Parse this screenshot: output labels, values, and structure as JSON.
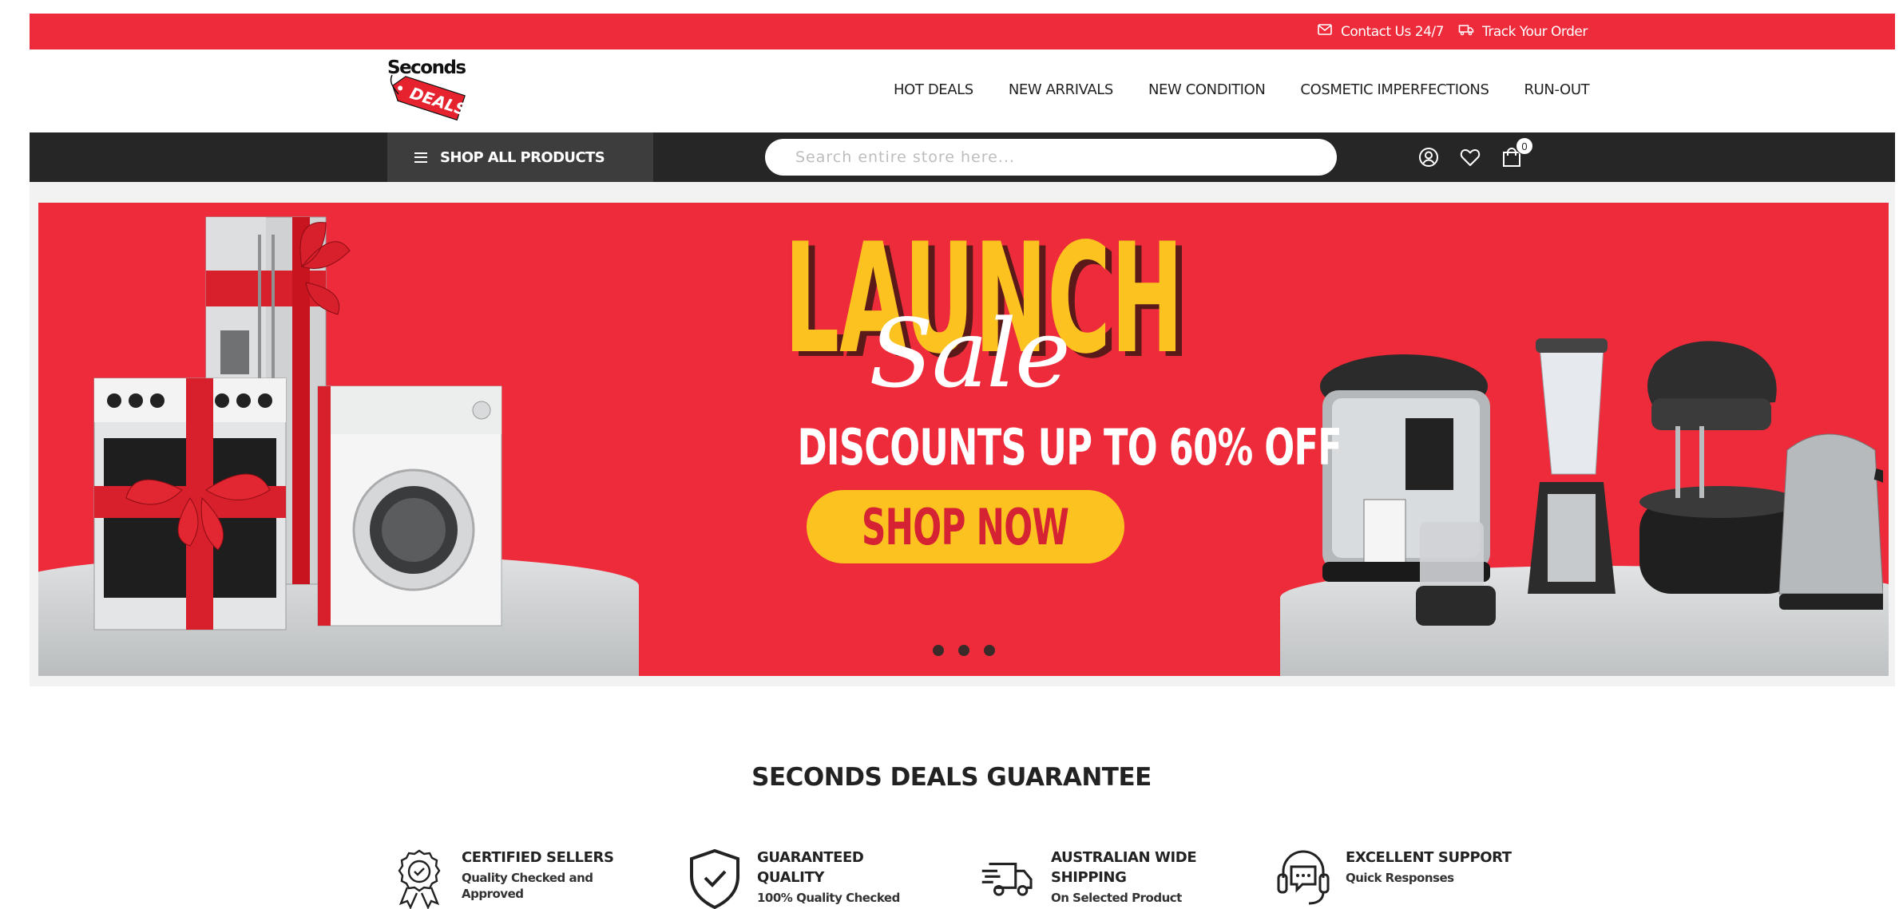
{
  "topbar": {
    "contact_label": "Contact Us 24/7",
    "track_label": "Track Your Order"
  },
  "header": {
    "logo_text_top": "Seconds",
    "logo_text_tag": "DEALS",
    "nav": [
      "HOT DEALS",
      "NEW ARRIVALS",
      "NEW CONDITION",
      "COSMETIC IMPERFECTIONS",
      "RUN-OUT"
    ]
  },
  "toolbar": {
    "shop_all_label": "SHOP ALL PRODUCTS",
    "search_placeholder": "Search entire store here...",
    "cart_count": "0",
    "icons": [
      "account-icon",
      "heart-icon",
      "cart-icon"
    ]
  },
  "hero": {
    "headline": "LAUNCH",
    "script": "Sale",
    "discount": "DISCOUNTS UP TO 60% OFF",
    "cta": "SHOP NOW",
    "slides": 3,
    "colors": {
      "background": "#ee2b3a",
      "accent": "#fcc320"
    }
  },
  "guarantee": {
    "title": "SECONDS DEALS GUARANTEE",
    "items": [
      {
        "icon": "award-ribbon-icon",
        "title": "CERTIFIED SELLERS",
        "subtitle_lines": [
          "Quality Checked and",
          "Approved"
        ]
      },
      {
        "icon": "shield-check-icon",
        "title_lines": [
          "GUARANTEED",
          "QUALITY"
        ],
        "subtitle": "100% Quality Checked"
      },
      {
        "icon": "delivery-truck-icon",
        "title_lines": [
          "AUSTRALIAN WIDE",
          "SHIPPING"
        ],
        "subtitle": "On Selected Product"
      },
      {
        "icon": "headset-support-icon",
        "title": "EXCELLENT SUPPORT",
        "subtitle": "Quick Responses"
      }
    ]
  }
}
